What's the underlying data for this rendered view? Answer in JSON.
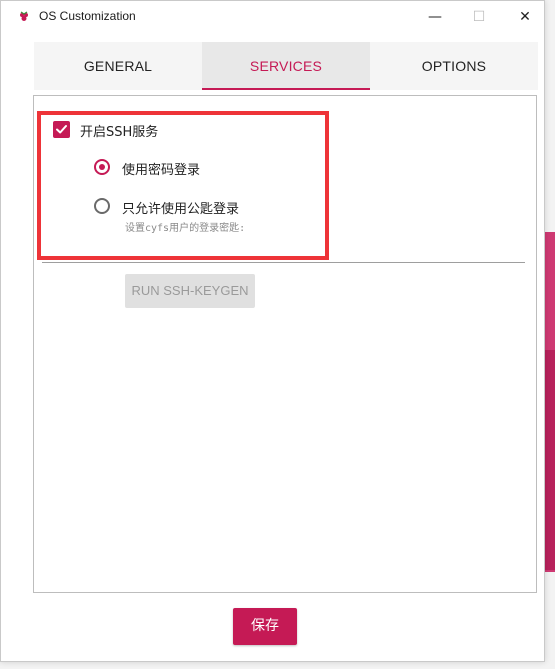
{
  "window": {
    "title": "OS Customization",
    "minimize": "—",
    "maximize": "☐",
    "close": "✕"
  },
  "tabs": [
    {
      "label": "GENERAL",
      "active": false
    },
    {
      "label": "SERVICES",
      "active": true
    },
    {
      "label": "OPTIONS",
      "active": false
    }
  ],
  "services": {
    "enable_ssh_label": "开启SSH服务",
    "enable_ssh_checked": true,
    "auth_options": [
      {
        "label": "使用密码登录",
        "selected": true
      },
      {
        "label": "只允许使用公匙登录",
        "selected": false
      }
    ],
    "public_key_hint": "设置cyfs用户的登录密匙:",
    "keygen_button": "RUN SSH-KEYGEN"
  },
  "footer": {
    "save_label": "保存"
  },
  "colors": {
    "accent": "#c51a55",
    "highlight_box": "#ee3338"
  }
}
